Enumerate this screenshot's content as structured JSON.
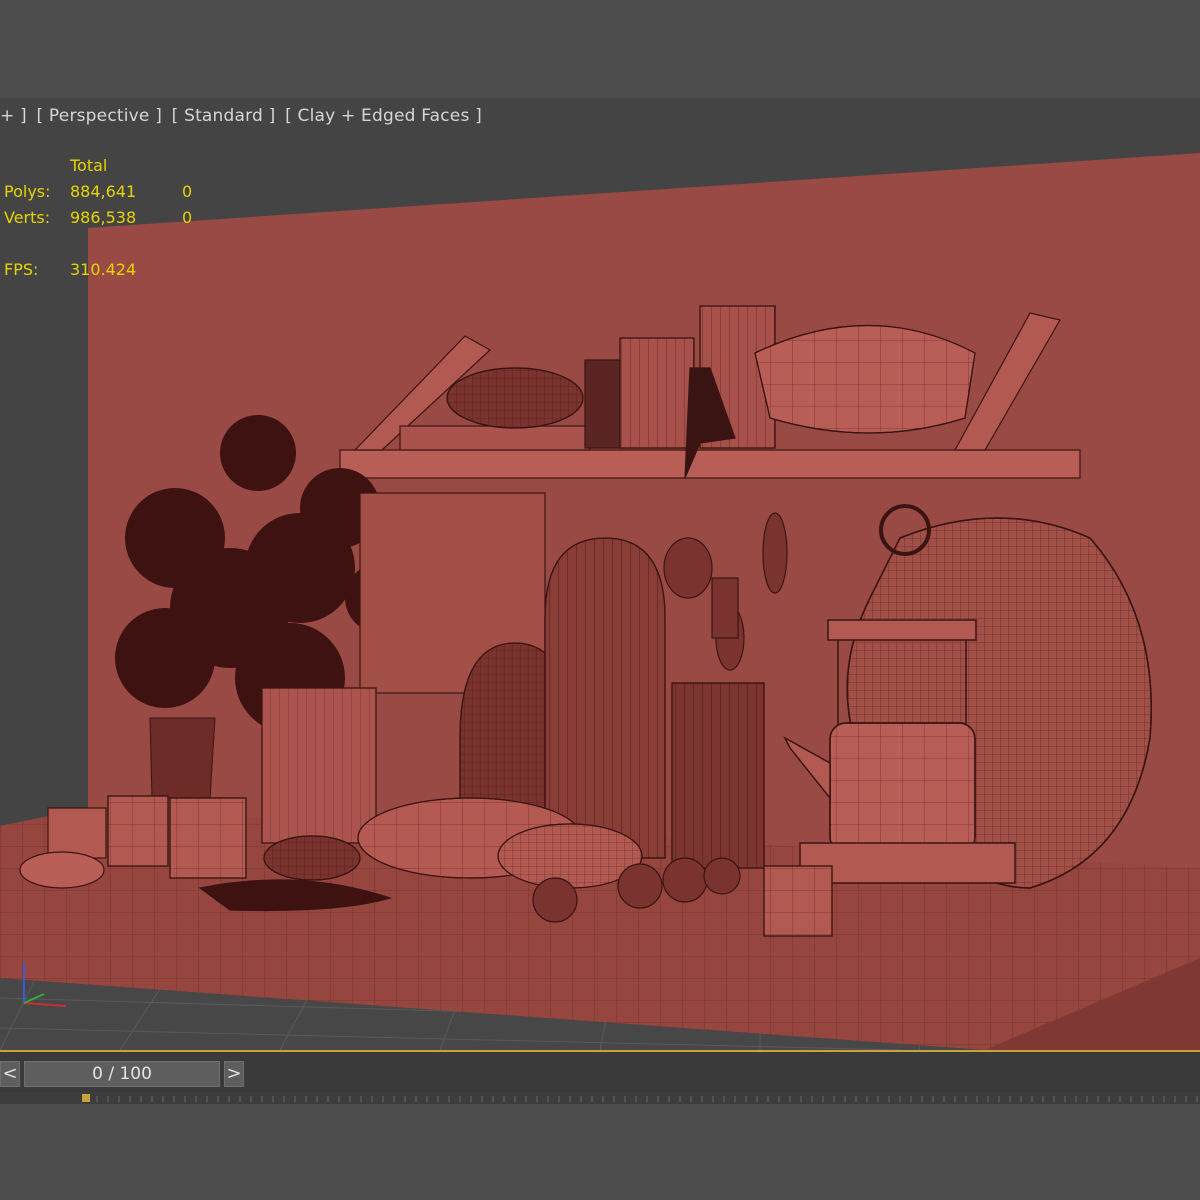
{
  "viewport": {
    "label_items": [
      "+ ]",
      "[ Perspective ]",
      "[ Standard ]",
      "[ Clay + Edged Faces ]"
    ],
    "stats": {
      "header": "Total",
      "polys_label": "Polys:",
      "polys_value": "884,641",
      "polys_selected": "0",
      "verts_label": "Verts:",
      "verts_value": "986,538",
      "verts_selected": "0",
      "fps_label": "FPS:",
      "fps_value": "310.424"
    }
  },
  "timeline": {
    "prev_label": "<",
    "next_label": ">",
    "frame_display": "0 / 100",
    "current_frame": 0,
    "total_frames": 100
  },
  "colors": {
    "wall": "#9a4a45",
    "floor": "#96453f",
    "wire": "#3a1412",
    "stats_text": "#e6d300",
    "timeline_accent": "#c8a23c"
  }
}
